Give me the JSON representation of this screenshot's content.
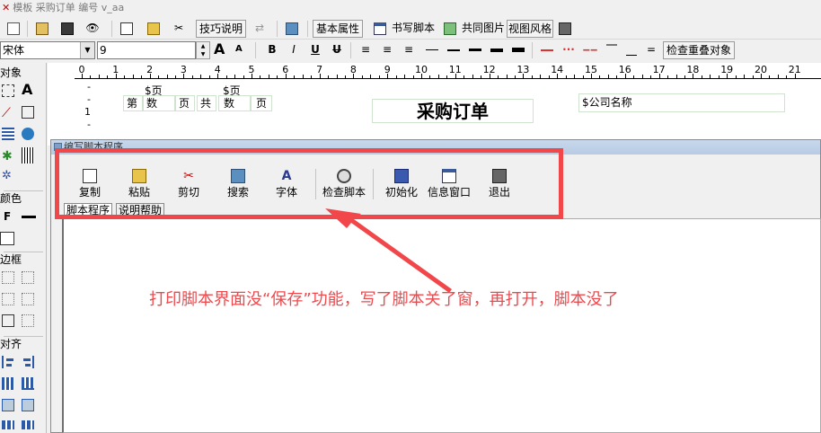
{
  "window": {
    "title": "模板 采购订单 编号 v_aa"
  },
  "toolbar1": {
    "tips_label": "技巧说明",
    "basic_props_label": "基本属性",
    "write_script_label": "书写脚本",
    "shared_image_label": "共同图片",
    "view_style_label": "视图风格"
  },
  "toolbar2": {
    "font_name": "宋体",
    "font_size": "9",
    "bold_label": "B",
    "italic_label": "I",
    "underline_label": "U",
    "strike_label": "U",
    "check_overlap_label": "检查重叠对象",
    "big_a": "A",
    "small_a": "A"
  },
  "left_panel": {
    "objects_header": "对象",
    "text_tool": "A",
    "color_header": "颜色",
    "font_color": "F",
    "border_header": "边框",
    "align_header": "对齐"
  },
  "ruler": {
    "ticks": [
      "0",
      "1",
      "2",
      "3",
      "4",
      "5",
      "6",
      "7",
      "8",
      "9",
      "10",
      "11",
      "12",
      "13",
      "14",
      "15",
      "16",
      "17",
      "18",
      "19",
      "20",
      "21"
    ],
    "v_ticks": [
      "-",
      "-",
      "1",
      "-"
    ]
  },
  "canvas": {
    "page_tag1": "$页",
    "page_tag2": "$页",
    "di": "第",
    "shu1": "数",
    "ye1": "页",
    "gong": "共",
    "shu2": "数",
    "ye2": "页",
    "report_title": "采购订单",
    "company_field": "$公司名称"
  },
  "dialog": {
    "title": "编写脚本程序",
    "tools": {
      "copy": "复制",
      "paste": "粘贴",
      "cut": "剪切",
      "search": "搜索",
      "font": "字体",
      "check_script": "检查脚本",
      "init": "初始化",
      "info_window": "信息窗口",
      "exit": "退出"
    },
    "tabs": {
      "script": "脚本程序",
      "help": "说明帮助"
    }
  },
  "annotation": {
    "text": "打印脚本界面没“保存”功能，写了脚本关了窗，再打开，脚本没了"
  },
  "colors": {
    "highlight": "#f2474a",
    "annotation": "#ee4a4e",
    "red_line": "#e03030"
  }
}
